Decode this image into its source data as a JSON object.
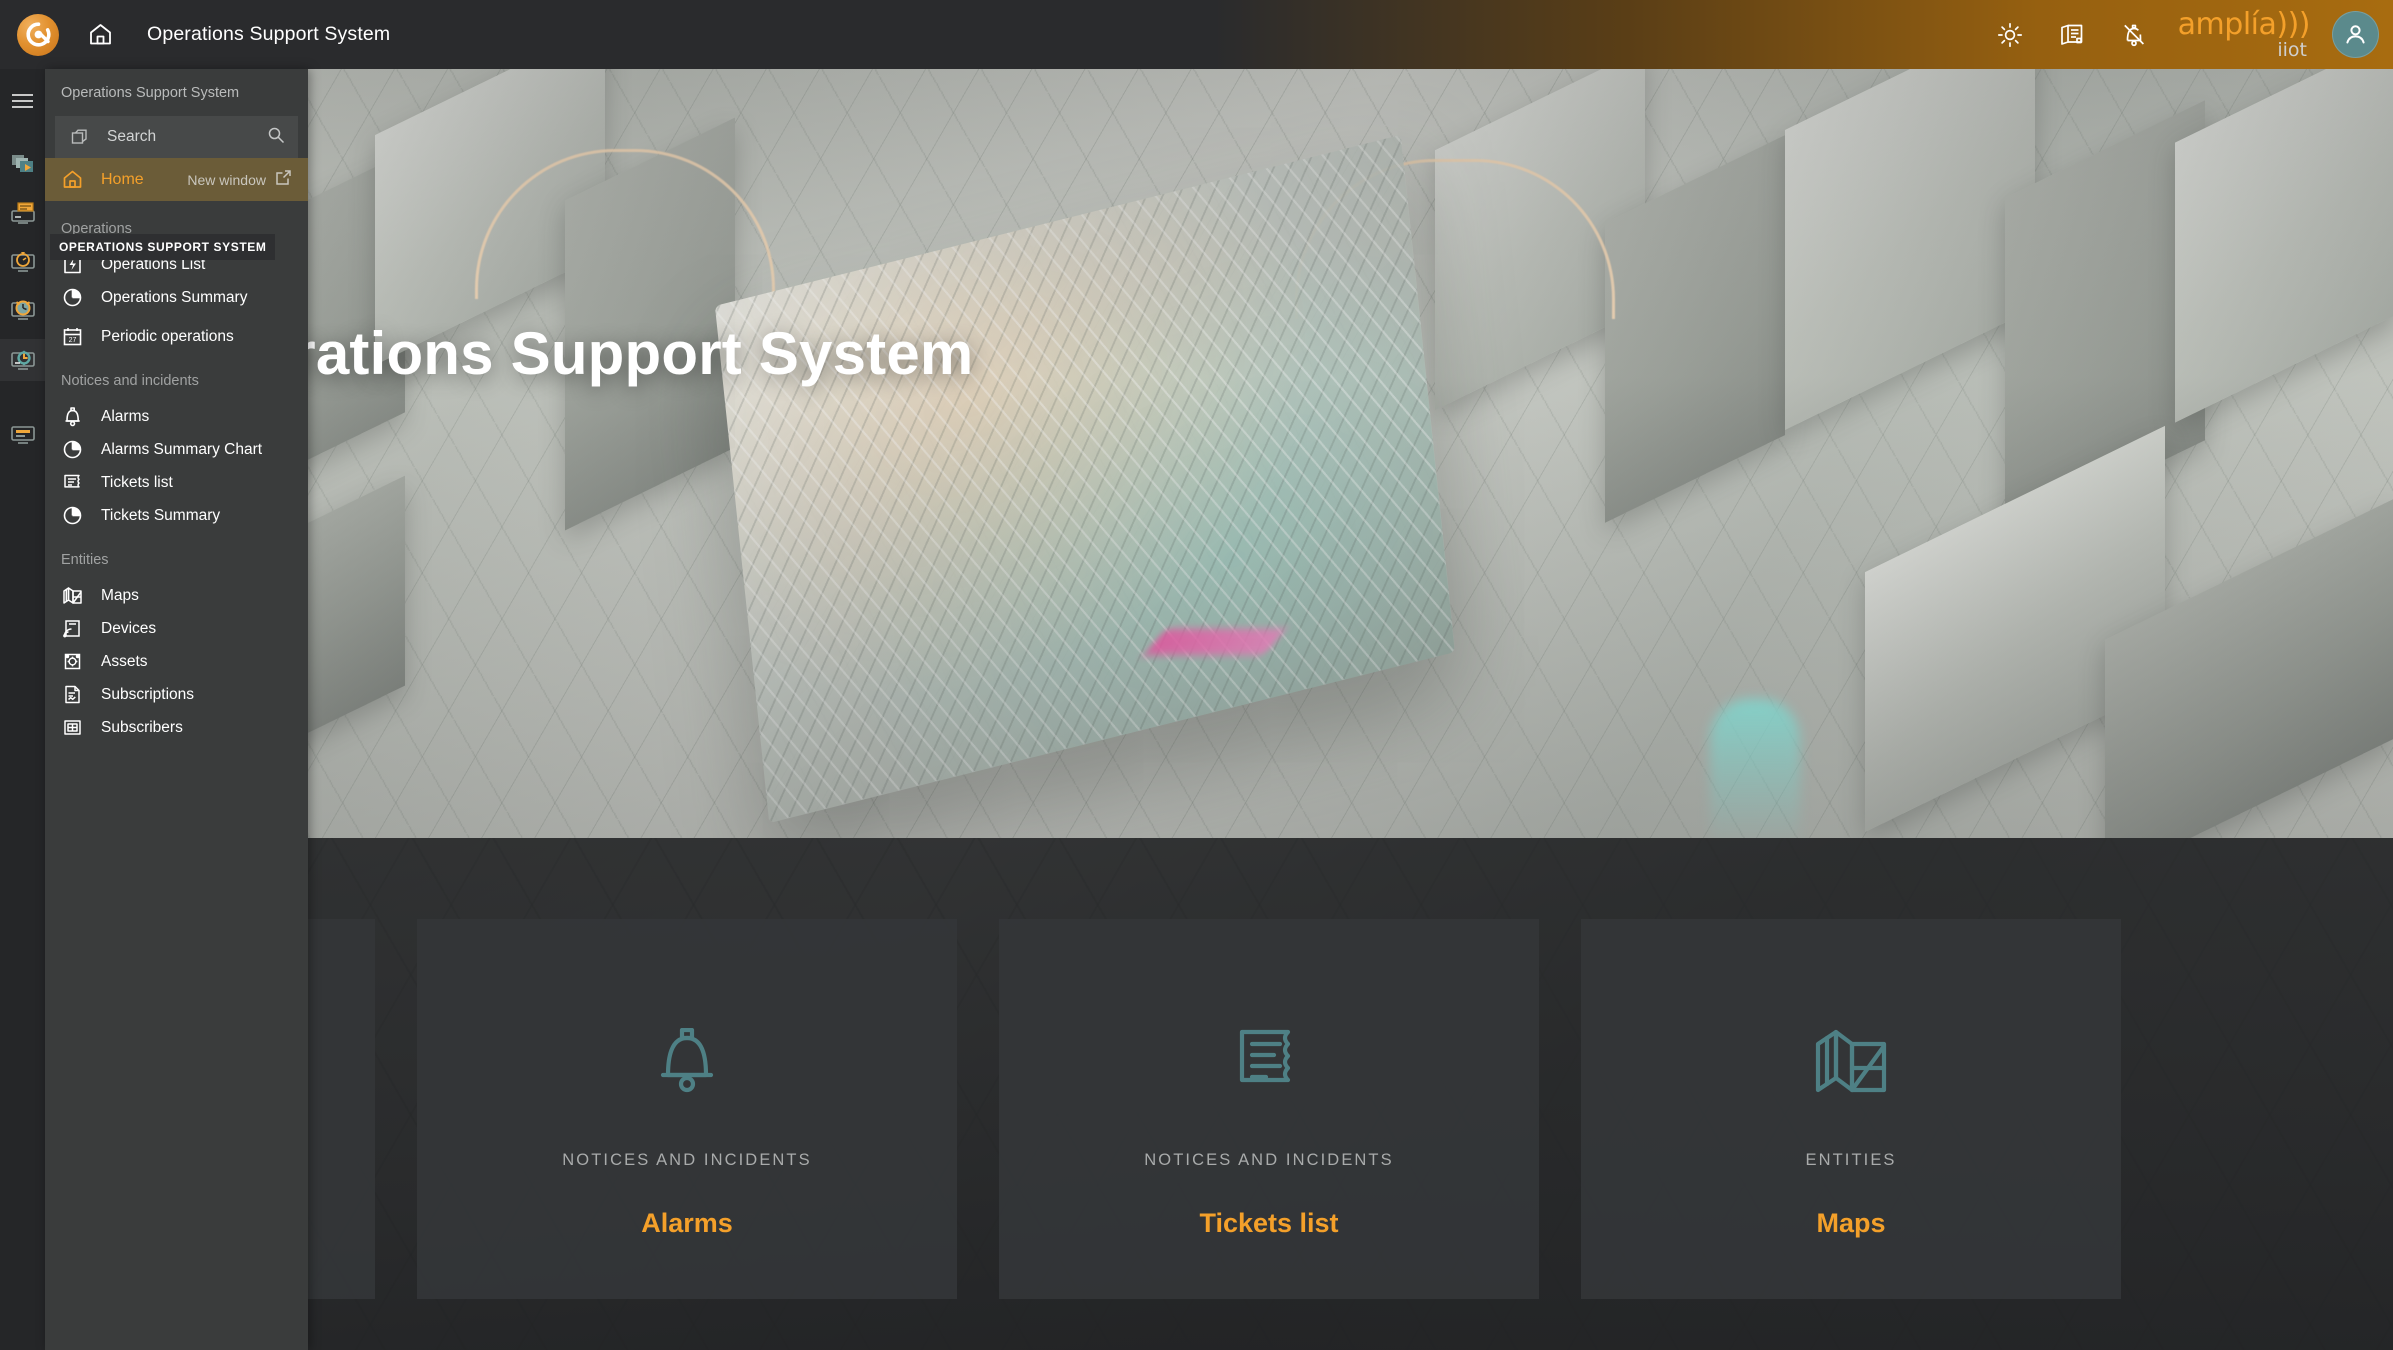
{
  "header": {
    "app_title": "Operations Support System",
    "logo_name": "amplia-circle-logo",
    "home_icon": "home-icon",
    "icons": [
      {
        "name": "brightness-icon",
        "label": "Brightness"
      },
      {
        "name": "documentation-icon",
        "label": "Documentation"
      },
      {
        "name": "notifications-off-icon",
        "label": "Notifications muted"
      }
    ],
    "brand": {
      "word": "amplía)))",
      "sub": "iiot"
    },
    "avatar_name": "user-avatar"
  },
  "rail": {
    "menu_icon": "hamburger-menu-icon",
    "items": [
      {
        "name": "rail-item-layers",
        "label": "Layers"
      },
      {
        "name": "rail-item-reports",
        "label": "Reports"
      },
      {
        "name": "rail-item-monitoring",
        "label": "Monitoring"
      },
      {
        "name": "rail-item-scheduling",
        "label": "Scheduling"
      },
      {
        "name": "rail-item-operations",
        "label": "Operations Support System",
        "active": true
      },
      {
        "name": "rail-item-settings",
        "label": "Settings"
      }
    ]
  },
  "sidebar": {
    "title": "Operations Support System",
    "search": {
      "placeholder": "Search",
      "icon": "search-icon",
      "left_icon": "module-icon"
    },
    "home": {
      "label": "Home",
      "action": "New window",
      "icon": "home-icon",
      "action_icon": "external-link-icon"
    },
    "groups": [
      {
        "label": "Operations",
        "items": [
          {
            "label": "Operations List",
            "icon": "operations-list-icon"
          },
          {
            "label": "Operations Summary",
            "icon": "pie-chart-icon"
          },
          {
            "label": "Periodic operations",
            "icon": "calendar-icon"
          }
        ]
      },
      {
        "label": "Notices and incidents",
        "items": [
          {
            "label": "Alarms",
            "icon": "bell-icon"
          },
          {
            "label": "Alarms Summary Chart",
            "icon": "pie-chart-icon"
          },
          {
            "label": "Tickets list",
            "icon": "ticket-icon"
          },
          {
            "label": "Tickets Summary",
            "icon": "pie-chart-icon"
          }
        ]
      },
      {
        "label": "Entities",
        "items": [
          {
            "label": "Maps",
            "icon": "map-icon"
          },
          {
            "label": "Devices",
            "icon": "device-signal-icon"
          },
          {
            "label": "Assets",
            "icon": "asset-gear-icon"
          },
          {
            "label": "Subscriptions",
            "icon": "subscription-doc-icon"
          },
          {
            "label": "Subscribers",
            "icon": "subscribers-card-icon"
          }
        ]
      }
    ]
  },
  "tooltip": {
    "text": "OPERATIONS SUPPORT SYSTEM"
  },
  "hero": {
    "title": "Operations Support System"
  },
  "cards": [
    {
      "section": "",
      "title": "",
      "icon": "partial-card-icon",
      "partial": true
    },
    {
      "section": "Notices and incidents",
      "title": "Alarms",
      "icon": "bell-icon"
    },
    {
      "section": "Notices and incidents",
      "title": "Tickets list",
      "icon": "ticket-icon"
    },
    {
      "section": "Entities",
      "title": "Maps",
      "icon": "map-icon"
    }
  ],
  "colors": {
    "accent_orange": "#f4a02a",
    "card_teal": "#4e8085",
    "panel_bg": "#3a3c3c",
    "topbar_bg": "#2a2b2d",
    "home_highlight": "#6b5c38",
    "avatar_bg": "#5b8a8c"
  }
}
